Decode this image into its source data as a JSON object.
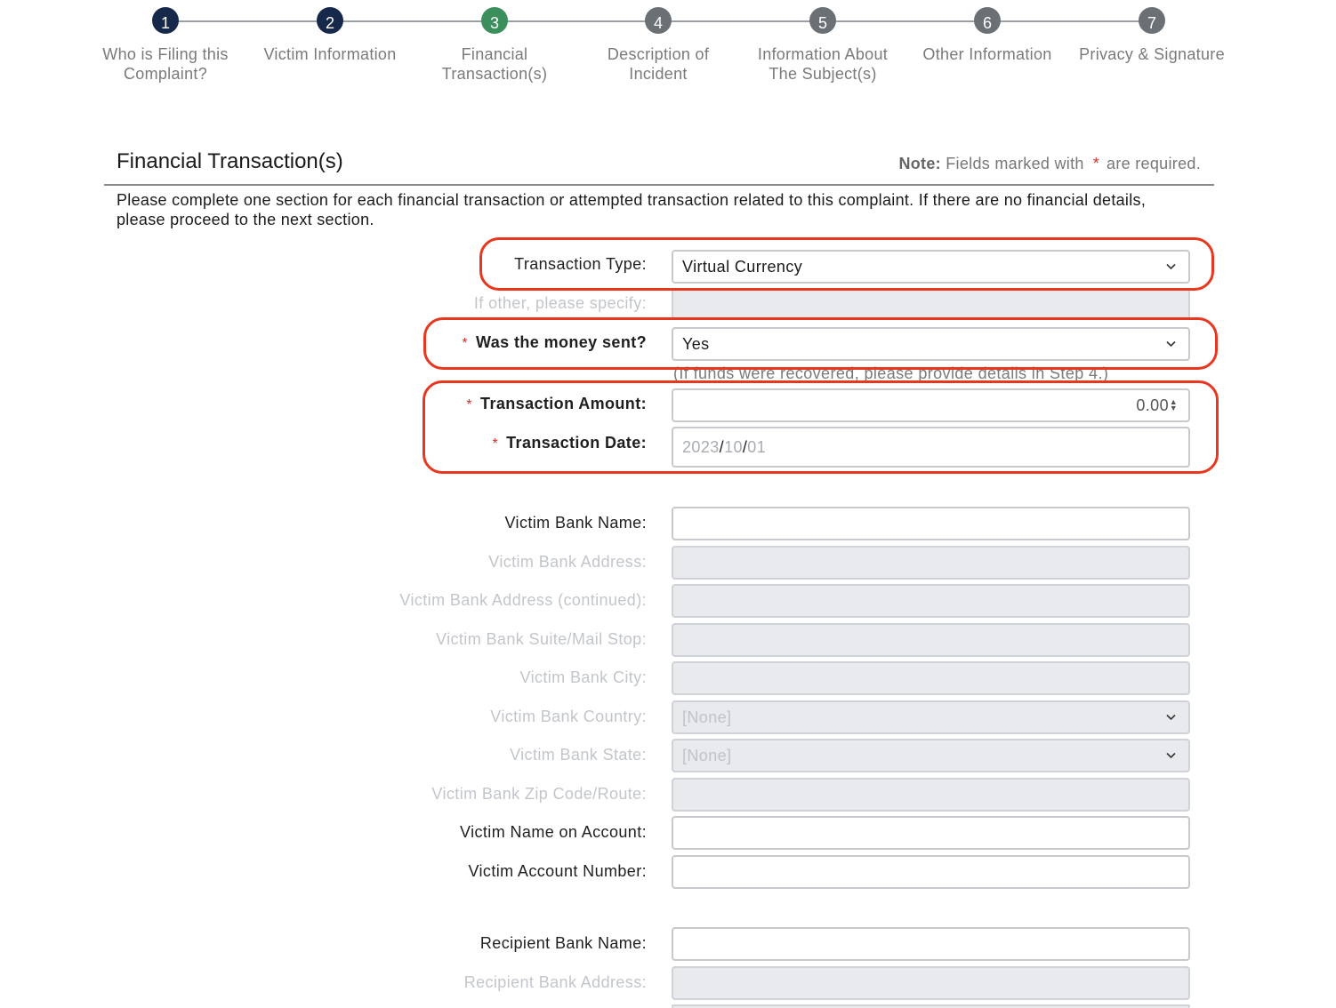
{
  "stepper": {
    "steps": [
      {
        "number": "1",
        "label": "Who is Filing this Complaint?",
        "state": "done"
      },
      {
        "number": "2",
        "label": "Victim Information",
        "state": "done"
      },
      {
        "number": "3",
        "label": "Financial Transaction(s)",
        "state": "current"
      },
      {
        "number": "4",
        "label": "Description of Incident",
        "state": "upcoming"
      },
      {
        "number": "5",
        "label": "Information About The Subject(s)",
        "state": "upcoming"
      },
      {
        "number": "6",
        "label": "Other Information",
        "state": "upcoming"
      },
      {
        "number": "7",
        "label": "Privacy & Signature",
        "state": "upcoming"
      }
    ]
  },
  "section": {
    "title": "Financial Transaction(s)",
    "note_bold": "Note:",
    "note_text": "Fields marked with",
    "note_star": "*",
    "note_tail": "are required.",
    "intro": "Please complete one section for each financial transaction or attempted transaction related to this complaint. If there are no financial details, please proceed to the next section."
  },
  "form": {
    "transaction_type": {
      "label": "Transaction Type:",
      "value": "Virtual Currency"
    },
    "other_specify": {
      "label": "If other, please specify:",
      "value": ""
    },
    "money_sent": {
      "label": "Was the money sent?",
      "value": "Yes",
      "hint": "(If funds were recovered, please provide details in Step 4.)"
    },
    "amount": {
      "label": "Transaction Amount:",
      "value": "0.00"
    },
    "date": {
      "label": "Transaction Date:",
      "year": "2023",
      "month": "10",
      "day": "01",
      "sep": "/"
    },
    "victim_bank_name": {
      "label": "Victim Bank Name:",
      "value": ""
    },
    "victim_bank_address": {
      "label": "Victim Bank Address:",
      "value": ""
    },
    "victim_bank_address2": {
      "label": "Victim Bank Address (continued):",
      "value": ""
    },
    "victim_bank_suite": {
      "label": "Victim Bank Suite/Mail Stop:",
      "value": ""
    },
    "victim_bank_city": {
      "label": "Victim Bank City:",
      "value": ""
    },
    "victim_bank_country": {
      "label": "Victim Bank Country:",
      "value": "[None]"
    },
    "victim_bank_state": {
      "label": "Victim Bank State:",
      "value": "[None]"
    },
    "victim_bank_zip": {
      "label": "Victim Bank Zip Code/Route:",
      "value": ""
    },
    "victim_name_on_account": {
      "label": "Victim Name on Account:",
      "value": ""
    },
    "victim_account_number": {
      "label": "Victim Account Number:",
      "value": ""
    },
    "recipient_bank_name": {
      "label": "Recipient Bank Name:",
      "value": ""
    },
    "recipient_bank_address": {
      "label": "Recipient Bank Address:",
      "value": ""
    }
  },
  "colors": {
    "required_star": "#d9302a",
    "highlight": "#e8361f",
    "step_done": "#17294a",
    "step_current": "#3a8f5c",
    "step_upcoming": "#6b7075"
  }
}
